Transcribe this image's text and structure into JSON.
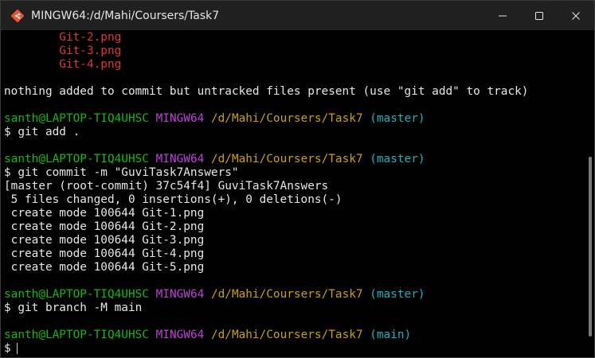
{
  "window": {
    "title": "MINGW64:/d/Mahi/Coursers/Task7",
    "app_icon": "git-bash-icon",
    "controls": [
      "minimize-icon",
      "maximize-icon",
      "close-icon"
    ]
  },
  "colors": {
    "background": "#000000",
    "titlebar": "#202020",
    "untracked_file": "#e0343a",
    "user_host": "#13b812",
    "shell": "#c13fd9",
    "path": "#c7a200",
    "branch": "#1ab2bf",
    "text": "#e6e6e6"
  },
  "terminal": {
    "untracked_files": [
      "\tGit-2.png",
      "\tGit-3.png",
      "\tGit-4.png"
    ],
    "nothing_added": "nothing added to commit but untracked files present (use \"git add\" to track)",
    "prompt1": {
      "user": "santh@LAPTOP-TIQ4UHSC",
      "shell": "MINGW64",
      "path": "/d/Mahi/Coursers/Task7",
      "branch": "(master)"
    },
    "cmd1": "$ git add .",
    "prompt2": {
      "user": "santh@LAPTOP-TIQ4UHSC",
      "shell": "MINGW64",
      "path": "/d/Mahi/Coursers/Task7",
      "branch": "(master)"
    },
    "cmd2": "$ git commit -m \"GuviTask7Answers\"",
    "commit_output": [
      "[master (root-commit) 37c54f4] GuviTask7Answers",
      " 5 files changed, 0 insertions(+), 0 deletions(-)",
      " create mode 100644 Git-1.png",
      " create mode 100644 Git-2.png",
      " create mode 100644 Git-3.png",
      " create mode 100644 Git-4.png",
      " create mode 100644 Git-5.png"
    ],
    "prompt3": {
      "user": "santh@LAPTOP-TIQ4UHSC",
      "shell": "MINGW64",
      "path": "/d/Mahi/Coursers/Task7",
      "branch": "(master)"
    },
    "cmd3": "$ git branch -M main",
    "prompt4": {
      "user": "santh@LAPTOP-TIQ4UHSC",
      "shell": "MINGW64",
      "path": "/d/Mahi/Coursers/Task7",
      "branch": "(main)"
    },
    "current_prompt": "$"
  }
}
